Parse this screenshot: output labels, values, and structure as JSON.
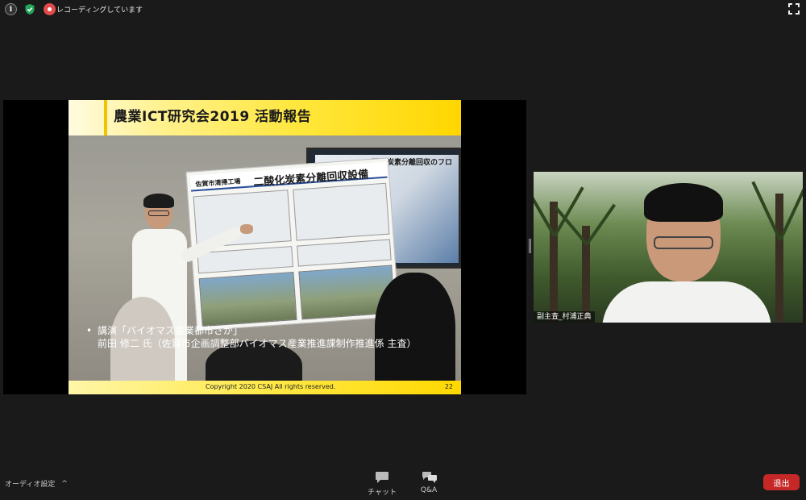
{
  "topbar": {
    "recording_label": "レコーディングしています",
    "icons": [
      "info-icon",
      "shield-check-icon",
      "recording-icon",
      "fullscreen-icon"
    ]
  },
  "slide": {
    "title": "農業ICT研究会2019 活動報告",
    "poster_title_small": "佐賀市清掃工場",
    "poster_title_large": "二酸化炭素分離回収設備",
    "monitor_title": "二酸化炭素分離回収のフロ",
    "caption_bullet": "•",
    "caption_line1": "講演「バイオマス産業都市さが」",
    "caption_line2": "前田 修二 氏（佐賀市企画調整部バイオマス産業推進課制作推進係 主査）",
    "copyright": "Copyright 2020 CSAJ All rights reserved.",
    "page_number": "22"
  },
  "participant_video": {
    "name": "副主査_村浦正典"
  },
  "bottombar": {
    "audio_settings_label": "オーディオ設定",
    "audio_chevron": "^",
    "chat_label": "チャット",
    "qa_label": "Q&A",
    "leave_label": "退出"
  },
  "colors": {
    "background": "#1a1a1a",
    "leave_button": "#c62828",
    "slide_accent": "#ffd600"
  }
}
